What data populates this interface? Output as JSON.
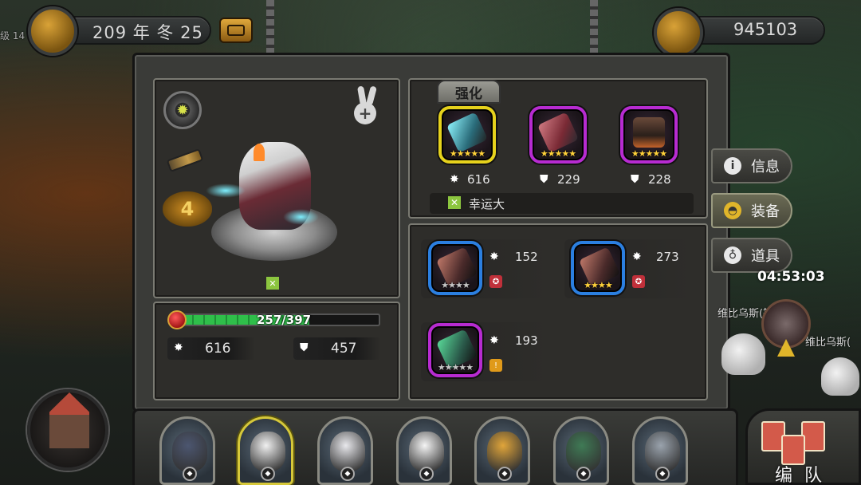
{
  "top_bar": {
    "side_label": "级 14",
    "date": "209 年 冬 25",
    "gold": "945103"
  },
  "hero": {
    "level": "4",
    "hp_text": "257/397",
    "hp_current": 257,
    "hp_max": 397,
    "attack": "616",
    "defense": "457"
  },
  "equipment": {
    "strengthen_label": "强化",
    "items": [
      {
        "rarity_color": "#e6d21c",
        "stars": "★★★★★",
        "stat_icon": "attack-icon",
        "stat": "616"
      },
      {
        "rarity_color": "#b72bd1",
        "stars": "★★★★★",
        "stat_icon": "defense-icon",
        "stat": "229"
      },
      {
        "rarity_color": "#b72bd1",
        "stars": "★★★★★",
        "stat_icon": "defense-icon",
        "stat": "228"
      }
    ],
    "trait_label": "幸运大"
  },
  "items_grid": [
    {
      "rarity_color": "#2b7fe0",
      "stars": "★★★★",
      "stat": "152",
      "badge_color": "#c0303a"
    },
    {
      "rarity_color": "#2b7fe0",
      "stars": "★★★★",
      "stat": "273",
      "badge_color": "#c0303a"
    },
    {
      "rarity_color": "#b72bd1",
      "stars": "★★★★★",
      "stat": "193",
      "badge_color": "#e09a1a"
    }
  ],
  "side_tabs": [
    {
      "label": "信息",
      "icon": "info-icon",
      "icon_glyph": "i"
    },
    {
      "label": "装备",
      "icon": "helmet-icon",
      "icon_glyph": "◓"
    },
    {
      "label": "道具",
      "icon": "bag-icon",
      "icon_glyph": "♁"
    }
  ],
  "map": {
    "timer": "04:53:03",
    "label_1": "维比乌斯(等级",
    "label_2": "维比乌斯("
  },
  "formation_label": "编 队",
  "roster": [
    {
      "name": "pirate-wolf",
      "face_color": "#4c5670",
      "selected": false
    },
    {
      "name": "eagle-knight",
      "face_color": "#f0f0f0",
      "selected": true
    },
    {
      "name": "sheep-mage",
      "face_color": "#e8e8ec",
      "selected": false
    },
    {
      "name": "polar-bear",
      "face_color": "#f4f4f4",
      "selected": false
    },
    {
      "name": "leopard",
      "face_color": "#e0a53a",
      "selected": false
    },
    {
      "name": "crocodile",
      "face_color": "#3f7a55",
      "selected": false
    },
    {
      "name": "elephant",
      "face_color": "#9aa3ad",
      "selected": false
    }
  ],
  "colors": {
    "hp_green": "#2fbf4a",
    "gold_accent": "#d9a237"
  }
}
